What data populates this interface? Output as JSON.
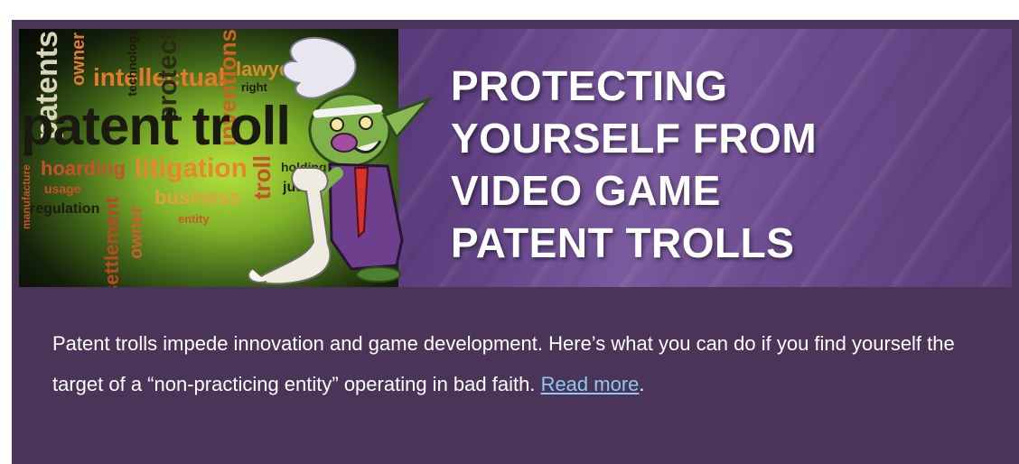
{
  "banner": {
    "headline_lines": [
      "PROTECTING",
      "YOURSELF FROM",
      "VIDEO GAME",
      "PATENT TROLLS"
    ],
    "wordcloud_words": [
      "patent troll",
      "patents",
      "litigation",
      "hoarding",
      "intellectual",
      "inventions",
      "lawyer",
      "business",
      "regulation",
      "settlement",
      "owner",
      "holding",
      "judge",
      "right",
      "usage",
      "entity",
      "manufacture",
      "protect",
      "technology",
      "troll"
    ]
  },
  "article": {
    "text": "Patent trolls impede innovation and game development. Here’s what you can do if you find yourself the target of a “non-practicing entity” operating in bad faith.",
    "link_label": "Read more",
    "trailing": "."
  },
  "colors": {
    "card_background": "#4a3458",
    "link": "#8ec9f2",
    "text": "#ffffff"
  }
}
